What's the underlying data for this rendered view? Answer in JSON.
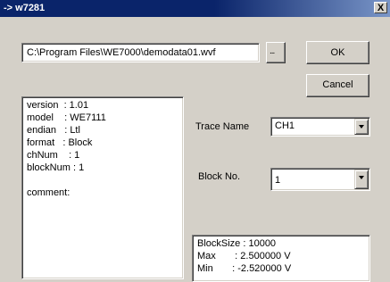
{
  "window": {
    "title": "-> w7281",
    "close_glyph": "X"
  },
  "file_path": "C:\\Program Files\\WE7000\\demodata01.wvf",
  "browse_label": "...",
  "buttons": {
    "ok": "OK",
    "cancel": "Cancel"
  },
  "info_lines": [
    "version  : 1.01",
    "model    : WE7111",
    "endian   : Ltl",
    "format   : Block",
    "chNum    : 1",
    "blockNum : 1",
    "",
    "comment:"
  ],
  "trace": {
    "label": "Trace Name",
    "value": "CH1"
  },
  "block": {
    "label": "Block No.",
    "value": "1"
  },
  "stats_lines": [
    "BlockSize : 10000",
    "Max       : 2.500000 V",
    "Min       : -2.520000 V"
  ],
  "icons": {
    "close": "close-icon",
    "dropdown": "chevron-down-icon"
  }
}
